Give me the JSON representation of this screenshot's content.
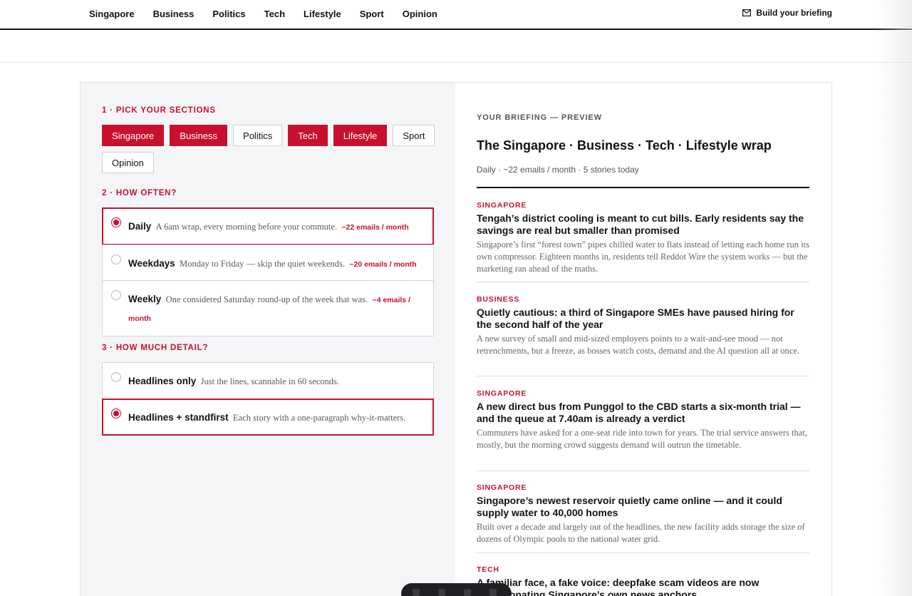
{
  "nav": {
    "links": [
      "Singapore",
      "Business",
      "Politics",
      "Tech",
      "Lifestyle",
      "Sport",
      "Opinion"
    ],
    "briefing_link": "Build your briefing",
    "briefing_icon": "mail-icon"
  },
  "builder": {
    "step1": {
      "label": "1 · PICK YOUR SECTIONS"
    },
    "sections": [
      {
        "label": "Singapore",
        "selected": true
      },
      {
        "label": "Business",
        "selected": true
      },
      {
        "label": "Politics",
        "selected": false
      },
      {
        "label": "Tech",
        "selected": true
      },
      {
        "label": "Lifestyle",
        "selected": true
      },
      {
        "label": "Sport",
        "selected": false
      },
      {
        "label": "Opinion",
        "selected": false
      }
    ],
    "step2": {
      "label": "2 · HOW OFTEN?"
    },
    "frequency": [
      {
        "name": "Daily",
        "desc": "A 6am wrap, every morning before your commute.",
        "count": "~22 emails / month",
        "selected": true
      },
      {
        "name": "Weekdays",
        "desc": "Monday to Friday — skip the quiet weekends.",
        "count": "~20 emails / month",
        "selected": false
      },
      {
        "name": "Weekly",
        "desc": "One considered Saturday round-up of the week that was.",
        "count": "~4 emails / month",
        "selected": false
      }
    ],
    "step3": {
      "label": "3 · HOW MUCH DETAIL?"
    },
    "detail": [
      {
        "name": "Headlines only",
        "desc": "Just the lines, scannable in 60 seconds.",
        "selected": false
      },
      {
        "name": "Headlines + standfirst",
        "desc": "Each story with a one-paragraph why-it-matters.",
        "selected": true
      }
    ]
  },
  "preview": {
    "label": "YOUR BRIEFING — PREVIEW",
    "title": "The Singapore · Business · Tech · Lifestyle wrap",
    "meta": "Daily · ~22 emails / month · 5 stories today",
    "stories": [
      {
        "section": "SINGAPORE",
        "headline": "Tengah’s district cooling is meant to cut bills. Early residents say the savings are real but smaller than promised",
        "dek": "Singapore’s first “forest town” pipes chilled water to flats instead of letting each home run its own compressor. Eighteen months in, residents tell Reddot Wire the system works — but the marketing ran ahead of the maths."
      },
      {
        "section": "BUSINESS",
        "headline": "Quietly cautious: a third of Singapore SMEs have paused hiring for the second half of the year",
        "dek": "A new survey of small and mid-sized employers points to a wait-and-see mood — not retrenchments, but a freeze, as bosses watch costs, demand and the AI question all at once."
      },
      {
        "section": "SINGAPORE",
        "headline": "A new direct bus from Punggol to the CBD starts a six-month trial — and the queue at 7.40am is already a verdict",
        "dek": "Commuters have asked for a one-seat ride into town for years. The trial service answers that, mostly, but the morning crowd suggests demand will outrun the timetable."
      },
      {
        "section": "SINGAPORE",
        "headline": "Singapore’s newest reservoir quietly came online — and it could supply water to 40,000 homes",
        "dek": "Built over a decade and largely out of the headlines, the new facility adds storage the size of dozens of Olympic pools to the national water grid."
      },
      {
        "section": "TECH",
        "headline": "A familiar face, a fake voice: deepfake scam videos are now impersonating Singapore’s own news anchors",
        "dek": ""
      }
    ]
  },
  "colors": {
    "accent": "#c8102e",
    "text": "#121212",
    "panel_bg": "#f4f5f7"
  }
}
